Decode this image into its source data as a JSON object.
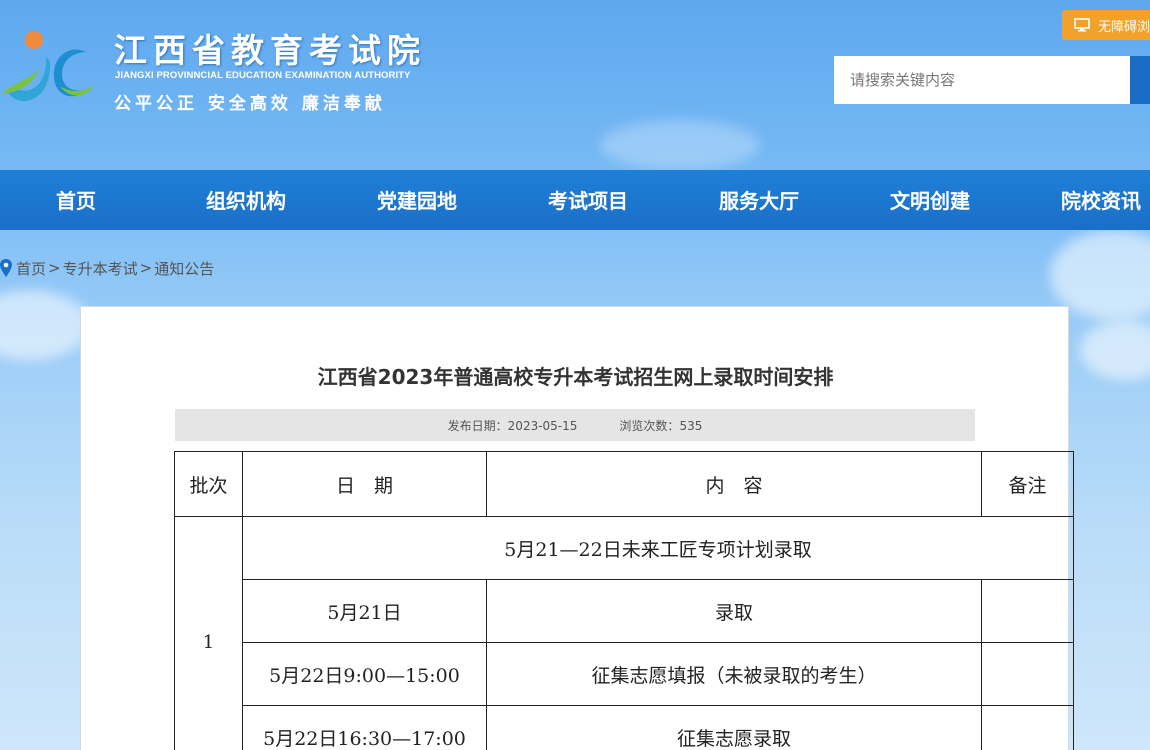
{
  "header": {
    "site_title": "江西省教育考试院",
    "site_title_en": "JIANGXI PROVINNCIAL EDUCATION EXAMINATION AUTHORITY",
    "slogan": "公平公正 安全高效 廉洁奉献",
    "accessibility_label": "无障碍浏览",
    "search_placeholder": "请搜索关键内容"
  },
  "nav": {
    "items": [
      "首页",
      "组织机构",
      "党建园地",
      "考试项目",
      "服务大厅",
      "文明创建",
      "院校资讯"
    ]
  },
  "breadcrumb": {
    "items": [
      "首页",
      "专升本考试",
      "通知公告"
    ],
    "separator": ">"
  },
  "article": {
    "title": "江西省2023年普通高校专升本考试招生网上录取时间安排",
    "publish_label": "发布日期：",
    "publish_date": "2023-05-15",
    "views_label": "浏览次数：",
    "views": "535"
  },
  "table": {
    "headers": [
      "批次",
      "日　期",
      "内　容",
      "备注"
    ],
    "batch": "1",
    "span_row": "5月21—22日未来工匠专项计划录取",
    "rows": [
      {
        "date": "5月21日",
        "content": "录取",
        "note": ""
      },
      {
        "date": "5月22日9:00—15:00",
        "content": "征集志愿填报（未被录取的考生）",
        "note": ""
      },
      {
        "date": "5月22日16:30—17:00",
        "content": "征集志愿录取",
        "note": ""
      }
    ]
  },
  "colors": {
    "nav_bg": "#1f7fd6",
    "accessibility_bg": "#f2a12a",
    "meta_bg": "#e5e5e5"
  }
}
